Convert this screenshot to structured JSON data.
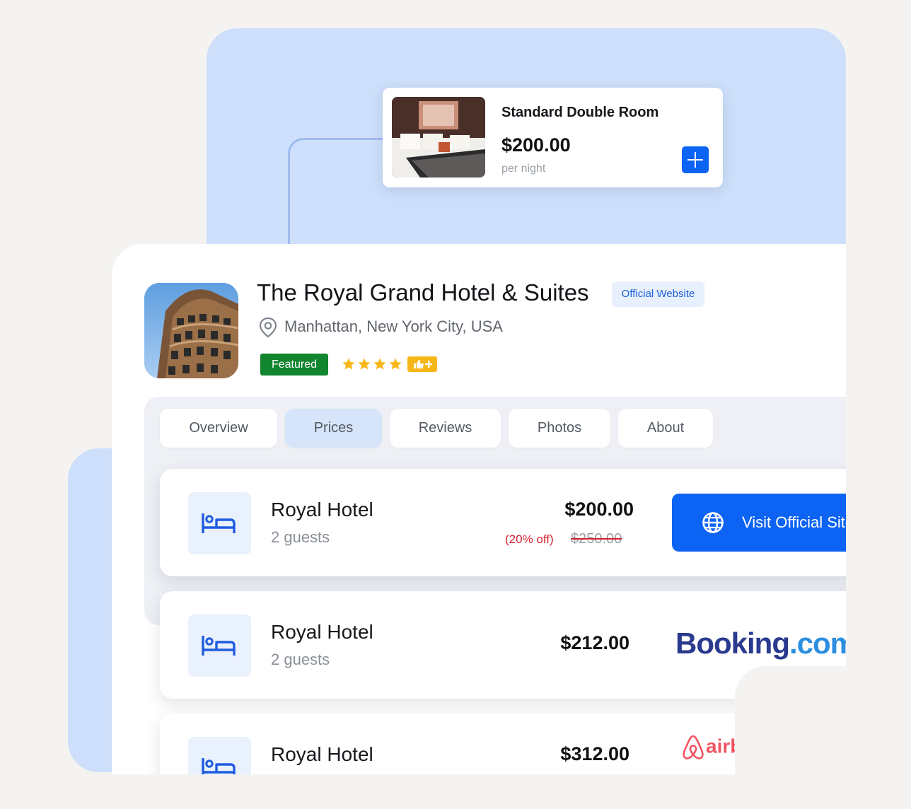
{
  "room_card": {
    "title": "Standard Double Room",
    "price": "$200.00",
    "unit": "per night",
    "add_icon": "plus-icon"
  },
  "hotel": {
    "name": "The Royal Grand Hotel & Suites",
    "official_badge": "Official Website",
    "location": "Manhattan, New York City, USA",
    "featured_label": "Featured",
    "star_rating": 4,
    "icons": {
      "location": "map-pin-icon",
      "star": "star-icon",
      "bonus": "thumbs-up-plus-icon"
    }
  },
  "tabs": [
    {
      "label": "Overview",
      "active": false
    },
    {
      "label": "Prices",
      "active": true
    },
    {
      "label": "Reviews",
      "active": false
    },
    {
      "label": "Photos",
      "active": false
    },
    {
      "label": "About",
      "active": false
    }
  ],
  "offers": [
    {
      "name": "Royal Hotel",
      "guests": "2 guests",
      "price": "$200.00",
      "discount": "(20% off)",
      "original_price": "$250.00",
      "action_label": "Visit Official Site",
      "action_icon": "globe-icon"
    },
    {
      "name": "Royal Hotel",
      "guests": "2 guests",
      "price": "$212.00",
      "provider_logo": {
        "part1": "Booking",
        "part2": ".com"
      }
    },
    {
      "name": "Royal Hotel",
      "price": "$312.00",
      "provider_logo": {
        "text": "airbnb"
      }
    }
  ],
  "colors": {
    "accent": "#0d63f3",
    "featured": "#12852f",
    "star": "#f7b719",
    "discount": "#d1212d",
    "panel_blue": "#cddffa"
  }
}
